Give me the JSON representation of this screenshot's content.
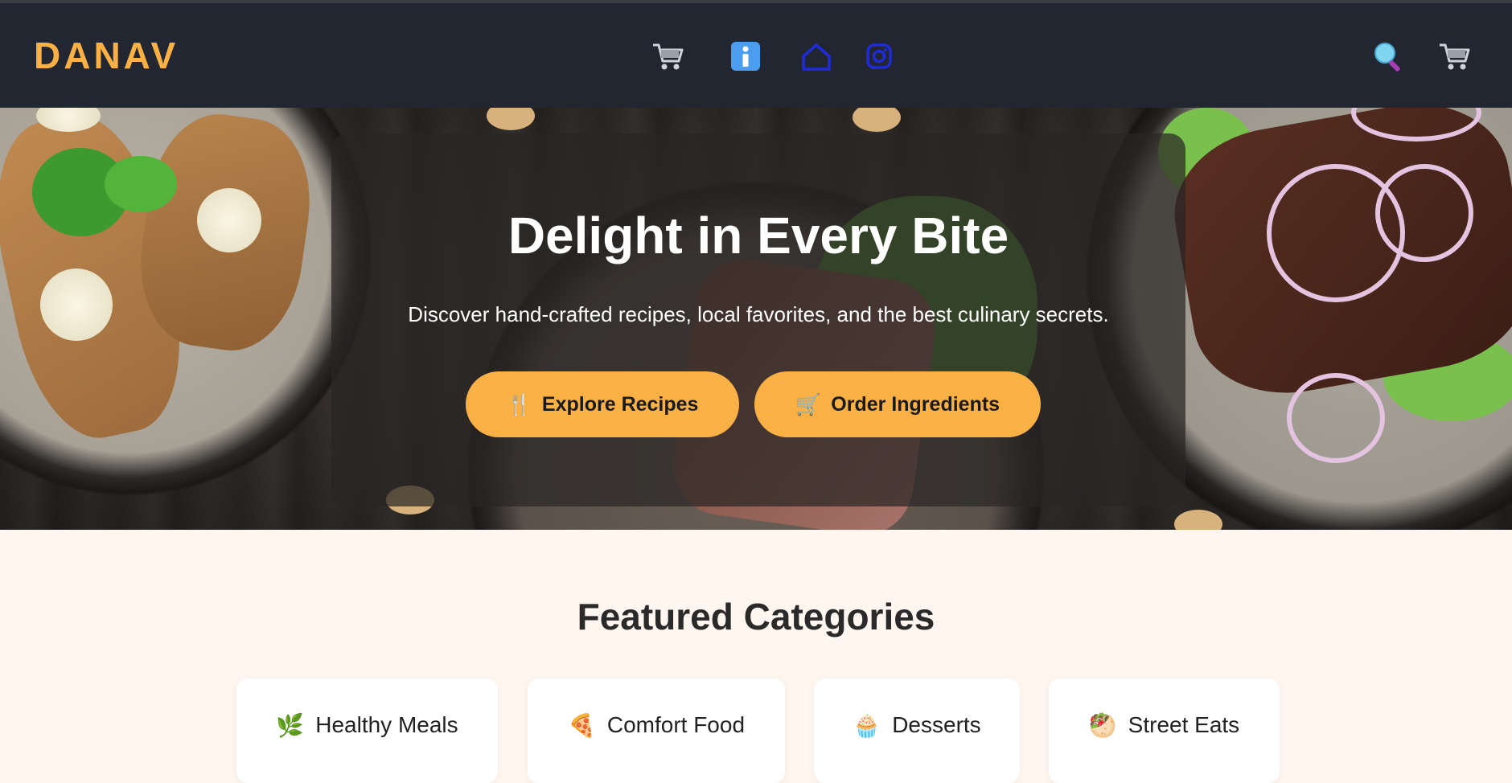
{
  "brand": {
    "logo_text": "DANAV",
    "accent_color": "#f9b044"
  },
  "nav": {
    "center_icons": [
      {
        "name": "cart-icon"
      },
      {
        "name": "info-icon"
      },
      {
        "name": "home-icon"
      },
      {
        "name": "instagram-icon"
      }
    ],
    "right_icons": [
      {
        "name": "search-icon"
      },
      {
        "name": "cart-icon"
      }
    ],
    "background_color": "#222630"
  },
  "hero": {
    "title": "Delight in Every Bite",
    "subtitle": "Discover hand-crafted recipes, local favorites, and the best culinary secrets.",
    "buttons": [
      {
        "icon": "🍴",
        "label": "Explore Recipes"
      },
      {
        "icon": "🛒",
        "label": "Order Ingredients"
      }
    ]
  },
  "featured": {
    "title": "Featured Categories",
    "categories": [
      {
        "icon": "🌿",
        "label": "Healthy Meals"
      },
      {
        "icon": "🍕",
        "label": "Comfort Food"
      },
      {
        "icon": "🧁",
        "label": "Desserts"
      },
      {
        "icon": "🥙",
        "label": "Street Eats"
      }
    ]
  }
}
